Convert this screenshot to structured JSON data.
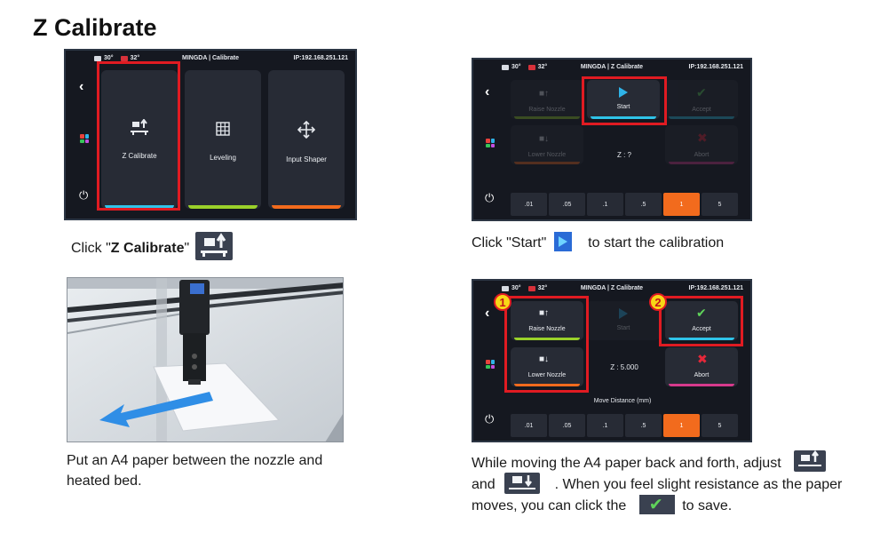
{
  "page": {
    "title": "Z Calibrate"
  },
  "screen_home": {
    "status": {
      "bed_temp": "30°",
      "nozzle_temp": "32°",
      "title": "MINGDA | Calibrate",
      "ip": "IP:192.168.251.121"
    },
    "cards": [
      {
        "label": "Z Calibrate",
        "icon": "z-calibrate-icon",
        "bar_color": "#2fc3e8"
      },
      {
        "label": "Leveling",
        "icon": "grid-icon",
        "bar_color": "#9ad12a"
      },
      {
        "label": "Input Shaper",
        "icon": "move-arrows-icon",
        "bar_color": "#f26b1d"
      }
    ]
  },
  "screen_start": {
    "status": {
      "bed_temp": "30°",
      "nozzle_temp": "32°",
      "title": "MINGDA  | Z Calibrate",
      "ip": "IP:192.168.251.121"
    },
    "buttons": {
      "raise": "Raise Nozzle",
      "start": "Start",
      "accept": "Accept",
      "lower": "Lower Nozzle",
      "abort": "Abort"
    },
    "z_value": "Z : ?",
    "distances": [
      ".01",
      ".05",
      ".1",
      ".5",
      "1",
      "5"
    ],
    "active_distance": "1"
  },
  "screen_adjust": {
    "status": {
      "bed_temp": "30°",
      "nozzle_temp": "32°",
      "title": "MINGDA  | Z Calibrate",
      "ip": "IP:192.168.251.121"
    },
    "buttons": {
      "raise": "Raise Nozzle",
      "start": "Start",
      "accept": "Accept",
      "lower": "Lower Nozzle",
      "abort": "Abort"
    },
    "z_value": "Z : 5.000",
    "move_distance_label": "Move Distance (mm)",
    "distances": [
      ".01",
      ".05",
      ".1",
      ".5",
      "1",
      "5"
    ],
    "active_distance": "1",
    "badges": [
      "1",
      "2"
    ]
  },
  "captions": {
    "step1_prefix": "Click \"",
    "step1_bold": "Z Calibrate",
    "step1_suffix": "\"",
    "step2_prefix": "Click \"Start\"",
    "step2_suffix": "to start the calibration",
    "step3_line1": "Put an A4 paper between the nozzle and",
    "step3_line2": "heated bed.",
    "step4_line1": "While moving the A4 paper back and forth, adjust",
    "step4_line2a": "and",
    "step4_line2b": ". When you feel slight resistance as the paper",
    "step4_line3a": "moves, you can click the",
    "step4_line3b": "to save."
  },
  "colors": {
    "highlight_red": "#e01b22",
    "badge_yellow": "#f8d716",
    "active_orange": "#f26b1d",
    "accent_cyan": "#2fc3e8",
    "accept_green": "#5fd35a",
    "abort_red": "#e5283a"
  }
}
